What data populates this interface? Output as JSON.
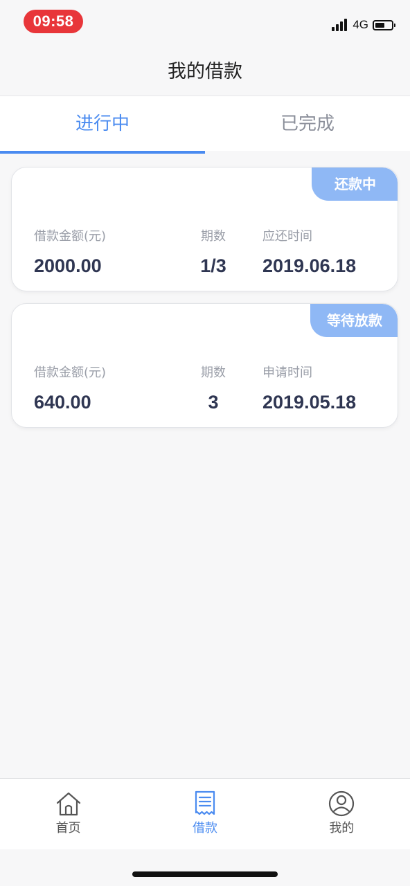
{
  "status_bar": {
    "time": "09:58",
    "network": "4G",
    "icons": [
      "signal-icon",
      "battery-icon"
    ]
  },
  "header": {
    "title": "我的借款"
  },
  "tabs": [
    {
      "label": "进行中",
      "active": true
    },
    {
      "label": "已完成",
      "active": false
    }
  ],
  "loans": [
    {
      "status": "还款中",
      "amount_label": "借款金额(元)",
      "amount": "2000.00",
      "periods_label": "期数",
      "periods": "1/3",
      "date_label": "应还时间",
      "date": "2019.06.18"
    },
    {
      "status": "等待放款",
      "amount_label": "借款金额(元)",
      "amount": "640.00",
      "periods_label": "期数",
      "periods": "3",
      "date_label": "申请时间",
      "date": "2019.05.18"
    }
  ],
  "bottom_nav": [
    {
      "label": "首页",
      "icon": "home-icon",
      "active": false
    },
    {
      "label": "借款",
      "icon": "loan-document-icon",
      "active": true
    },
    {
      "label": "我的",
      "icon": "profile-icon",
      "active": false
    }
  ],
  "colors": {
    "accent": "#4a8bf0",
    "badge": "#8fb8f5",
    "time_pill": "#e8363a",
    "value_text": "#2f3652"
  }
}
